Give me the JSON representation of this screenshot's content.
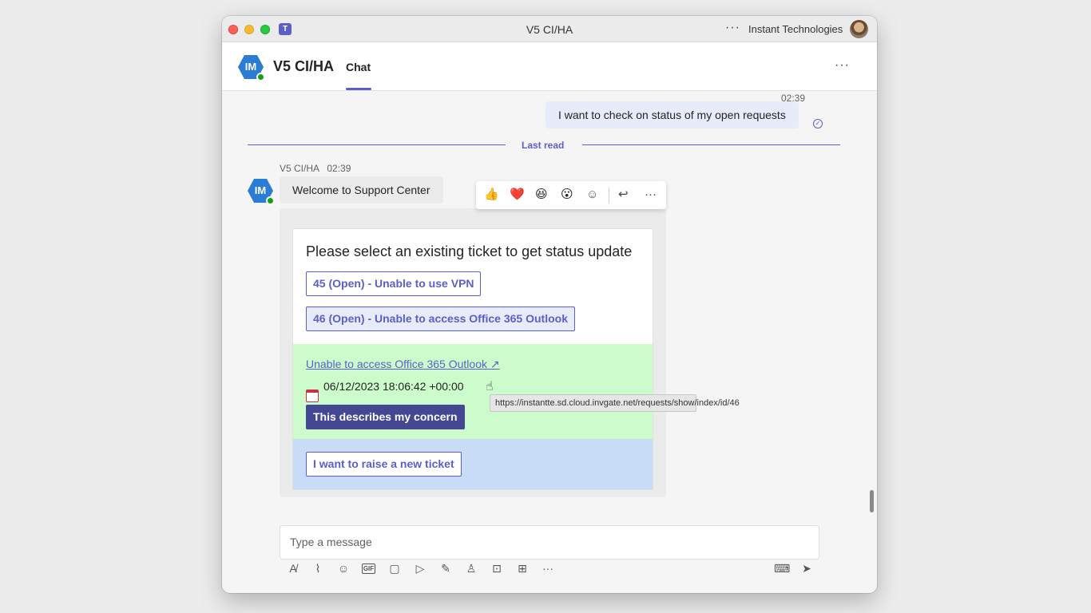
{
  "window": {
    "title": "V5 CI/HA",
    "org": "Instant Technologies",
    "more": "···"
  },
  "header": {
    "bot_initials": "IM",
    "title": "V5 CI/HA",
    "tab": "Chat",
    "more": "···"
  },
  "sent_message": {
    "time": "02:39",
    "text": "I want to check on status of my open requests"
  },
  "divider": {
    "label": "Last read"
  },
  "bot_message": {
    "sender": "V5 CI/HA",
    "time": "02:39",
    "text": "Welcome to Support Center"
  },
  "reactions": [
    "👍",
    "❤️",
    "😆",
    "😮",
    "☺",
    "↩",
    "···"
  ],
  "card": {
    "title": "Please select an existing ticket to get status update",
    "tickets": [
      "45 (Open) - Unable to use VPN",
      "46 (Open) - Unable to access Office 365 Outlook"
    ],
    "selected": {
      "link": "Unable to access Office 365 Outlook ↗",
      "date": "06/12/2023 18:06:42 +00:00",
      "action": "This describes my concern"
    },
    "new_ticket": "I want to raise a new ticket"
  },
  "tooltip": {
    "text": "https://instantte.sd.cloud.invgate.net/requests/show/index/id/46"
  },
  "compose": {
    "placeholder": "Type a message"
  },
  "toolbar_icons": [
    "format-icon",
    "attach-icon",
    "emoji-icon",
    "gif-icon",
    "sticker-icon",
    "schedule-icon",
    "loop-icon",
    "praise-icon",
    "apps-icon",
    "more-apps-icon",
    "more-icon"
  ],
  "colors": {
    "accent": "#5b5fc7",
    "action_button": "#444791",
    "green_section": "#ccfccc",
    "blue_section": "#c9dcf7"
  }
}
